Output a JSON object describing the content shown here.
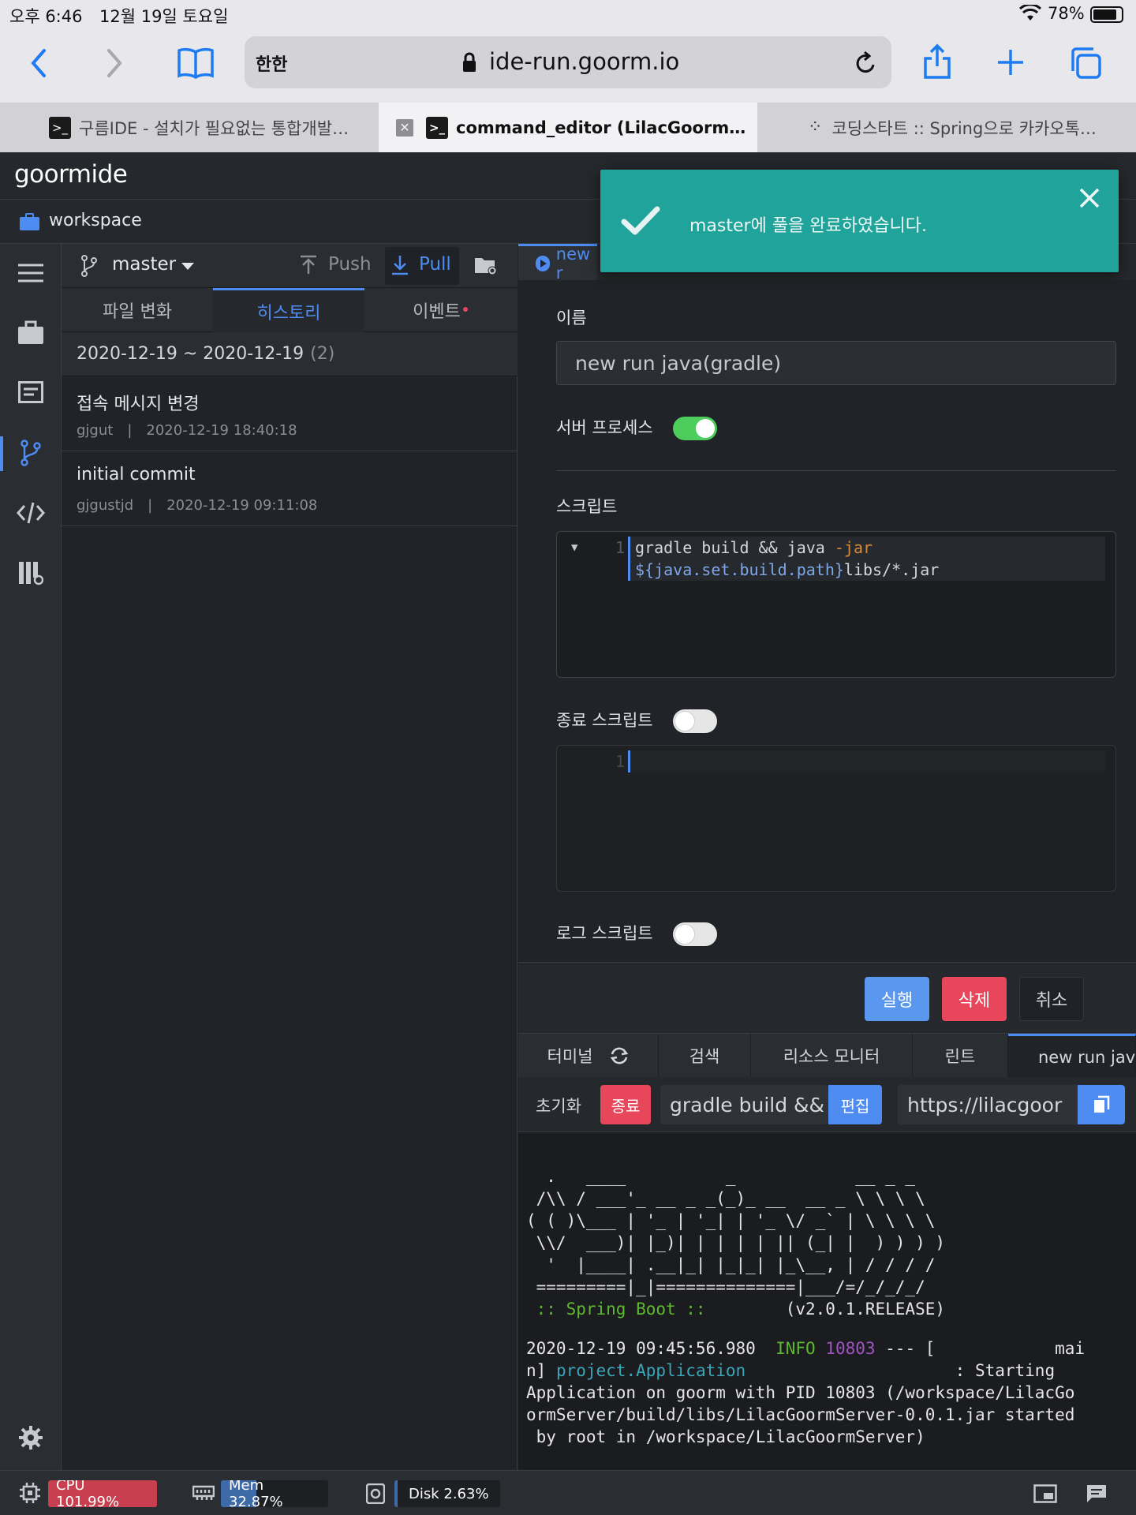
{
  "statusbar": {
    "time": "오후 6:46",
    "date": "12월 19일 토요일",
    "battery": "78%"
  },
  "safari": {
    "reader_text": "한한",
    "url": "ide-run.goorm.io"
  },
  "browser_tabs": [
    {
      "title": "구름IDE - 설치가 필요없는 통합개발…"
    },
    {
      "title": "command_editor (LilacGoorm…"
    },
    {
      "title": "코딩스타트 :: Spring으로 카카오톡…"
    }
  ],
  "ide": {
    "logo": "goormide",
    "workspace": "workspace"
  },
  "git": {
    "branch": "master",
    "push_label": "Push",
    "pull_label": "Pull",
    "tabs": [
      "파일 변화",
      "히스토리",
      "이벤트"
    ],
    "date_range": "2020-12-19 ~ 2020-12-19",
    "count": "(2)",
    "commits": [
      {
        "message": "접속 메시지 변경",
        "author": "gjgut",
        "sep": "|",
        "time": "2020-12-19 18:40:18"
      },
      {
        "message": "initial commit",
        "author": "gjgustjd",
        "sep": "|",
        "time": "2020-12-19 09:11:08"
      }
    ]
  },
  "editor": {
    "tab_label": "new r",
    "name_label": "이름",
    "name_value": "new run java(gradle)",
    "server_process_label": "서버 프로세스",
    "server_process_on": true,
    "script_label": "스크립트",
    "script_line_no": "1",
    "script_line1_a": "gradle build && java ",
    "script_line1_b": "-jar",
    "script_line2_a": "${java.set.build.path}",
    "script_line2_b": "libs/*.jar",
    "stop_script_label": "종료 스크립트",
    "stop_script_on": false,
    "stop_line_no": "1",
    "log_script_label": "로그 스크립트",
    "log_script_on": false,
    "run_button": "실행",
    "delete_button": "삭제",
    "cancel_button": "취소"
  },
  "terminal": {
    "tabs": [
      "터미널",
      "검색",
      "리소스 모니터",
      "린트",
      "new run java"
    ],
    "reset_label": "초기화",
    "stop_label": "종료",
    "command_value": "gradle build &&",
    "edit_label": "편집",
    "url_value": "https://lilacgoor",
    "banner": [
      "  .   ____          _            __ _ _",
      " /\\\\ / ___'_ __ _ _(_)_ __  __ _ \\ \\ \\ \\",
      "( ( )\\___ | '_ | '_| | '_ \\/ _` | \\ \\ \\ \\",
      " \\\\/  ___)| |_)| | | | | || (_| |  ) ) ) )",
      "  '  |____| .__|_| |_|_| |_\\__, | / / / /",
      " =========|_|==============|___/=/_/_/_/"
    ],
    "spring_label": " :: Spring Boot :: ",
    "spring_version": "       (v2.0.1.RELEASE)",
    "log_timestamp": "2020-12-19 09:45:56.980  ",
    "log_level": "INFO",
    "log_pid": " 10803",
    "log_mid": " --- [            mai",
    "log_n": "n] ",
    "log_class": "project.Application",
    "log_starting": "                     : Starting",
    "log_line3": "Application on goorm with PID 10803 (/workspace/LilacGo",
    "log_line4": "ormServer/build/libs/LilacGoormServer-0.0.1.jar started",
    "log_line5": " by root in /workspace/LilacGoormServer)"
  },
  "bottombar": {
    "cpu": "CPU 101.99%",
    "cpu_fraction": 1.0,
    "mem": "Mem 32.87%",
    "mem_fraction": 0.3287,
    "disk": "Disk 2.63%",
    "disk_fraction": 0.0263
  },
  "toast": {
    "message": "master에 풀을 완료하였습니다."
  },
  "colors": {
    "accent": "#4e8cf2",
    "danger": "#e8475b",
    "toast": "#1fa39a",
    "toggle_on": "#4ccd5c",
    "terminal_green": "#5fb832",
    "terminal_purple": "#a054c4",
    "terminal_cyan": "#3aa6b9"
  }
}
